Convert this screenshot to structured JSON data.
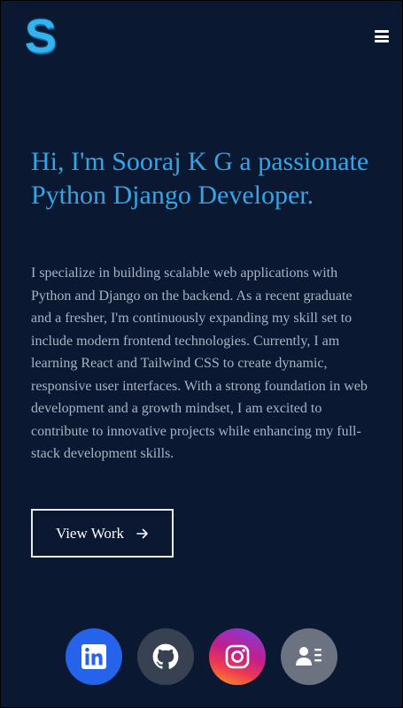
{
  "header": {
    "logo_letter": "S",
    "menu_icon": "hamburger-menu-icon"
  },
  "hero": {
    "headline": "Hi, I'm Sooraj K G a passionate Python Django Developer.",
    "bio": "I specialize in building scalable web applications with Python and Django on the backend. As a recent graduate and a fresher, I'm continuously expanding my skill set to include modern frontend technologies. Currently, I am learning React and Tailwind CSS to create dynamic, responsive user interfaces. With a strong foundation in web development and a growth mindset, I am excited to contribute to innovative projects while enhancing my full-stack development skills.",
    "cta_label": "View Work",
    "cta_icon": "arrow-right-icon"
  },
  "socials": [
    {
      "name": "linkedin",
      "icon": "linkedin-icon",
      "color": "#2563eb"
    },
    {
      "name": "github",
      "icon": "github-icon",
      "color": "#374151"
    },
    {
      "name": "instagram",
      "icon": "instagram-icon",
      "color": "#c21f8a"
    },
    {
      "name": "contact",
      "icon": "contact-card-icon",
      "color": "#6b7280"
    }
  ],
  "colors": {
    "background": "#0a1931",
    "accent": "#35a4e6",
    "body_text": "#a9b3c4"
  }
}
